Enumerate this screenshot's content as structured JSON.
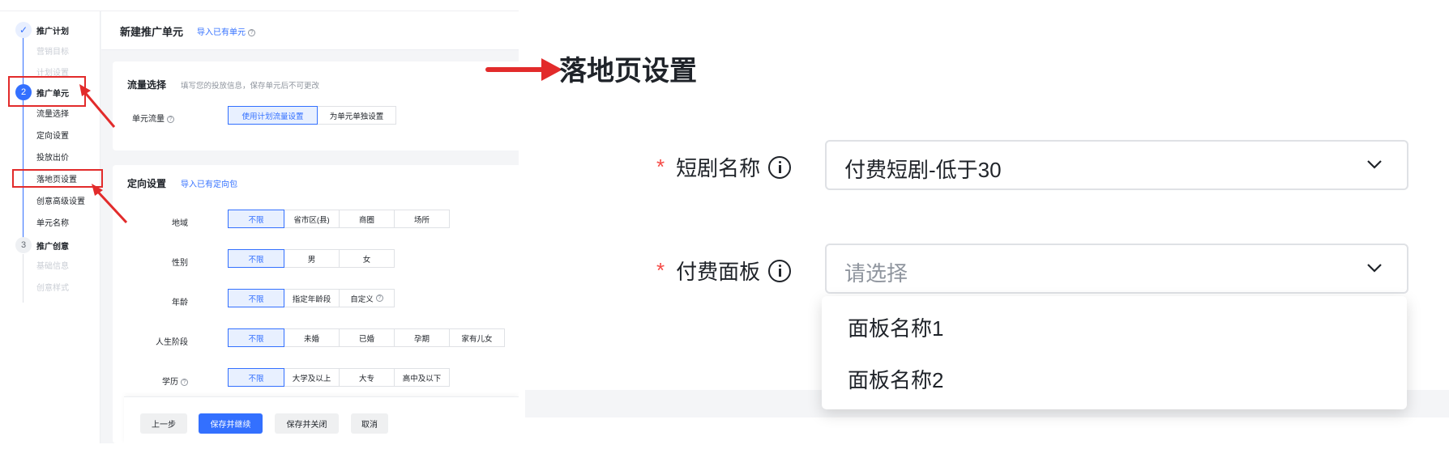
{
  "left": {
    "sidebar": {
      "steps": [
        {
          "number": "✓",
          "title": "推广计划",
          "subs": [
            "营销目标",
            "计划设置"
          ]
        },
        {
          "number": "2",
          "title": "推广单元",
          "subs": [
            "流量选择",
            "定向设置",
            "投放出价",
            "落地页设置",
            "创意高级设置",
            "单元名称"
          ]
        },
        {
          "number": "3",
          "title": "推广创意",
          "subs": [
            "基础信息",
            "创意样式"
          ]
        }
      ]
    },
    "header": {
      "title": "新建推广单元",
      "import_link": "导入已有单元",
      "help_icon": "?"
    },
    "traffic": {
      "title": "流量选择",
      "hint": "填写您的投放信息，保存单元后不可更改",
      "row_label": "单元流量",
      "options": [
        "使用计划流量设置",
        "为单元单独设置"
      ],
      "selected": "使用计划流量设置"
    },
    "targeting": {
      "title": "定向设置",
      "import_link": "导入已有定向包",
      "rows": [
        {
          "label": "地域",
          "options": [
            "不限",
            "省市区(县)",
            "商圈",
            "场所"
          ]
        },
        {
          "label": "性别",
          "options": [
            "不限",
            "男",
            "女"
          ]
        },
        {
          "label": "年龄",
          "options": [
            "不限",
            "指定年龄段",
            "自定义"
          ]
        },
        {
          "label": "人生阶段",
          "options": [
            "不限",
            "未婚",
            "已婚",
            "孕期",
            "家有儿女"
          ]
        },
        {
          "label": "学历",
          "options": [
            "不限",
            "大学及以上",
            "大专",
            "高中及以下"
          ]
        }
      ]
    },
    "footer": {
      "prev": "上一步",
      "save_continue": "保存并继续",
      "save_close": "保存并关闭",
      "cancel": "取消"
    }
  },
  "right": {
    "title": "落地页设置",
    "fields": [
      {
        "required": "*",
        "label": "短剧名称",
        "value": "付费短剧-低于30",
        "placeholder": ""
      },
      {
        "required": "*",
        "label": "付费面板",
        "value": "",
        "placeholder": "请选择"
      }
    ],
    "dropdown_options": [
      "面板名称1",
      "面板名称2"
    ]
  },
  "colors": {
    "accent": "#3370ff",
    "annotation_red": "#e22b2b",
    "required_red": "#f54a45"
  }
}
